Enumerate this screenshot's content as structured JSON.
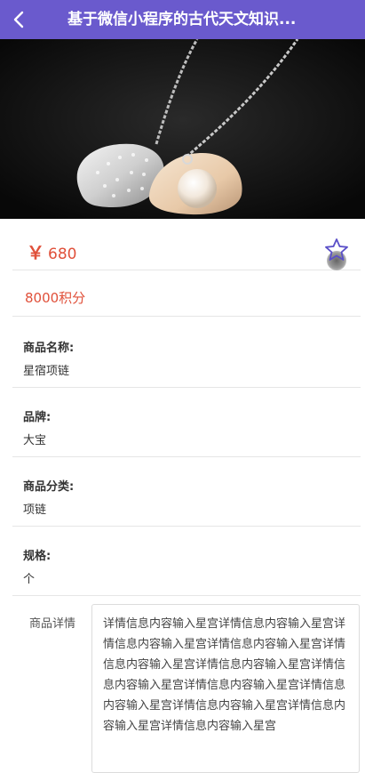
{
  "header": {
    "title": "基于微信小程序的古代天文知识...",
    "back_icon": "chevron-left-icon",
    "background": "#6a5acd"
  },
  "hero": {
    "image": "necklace-product-photo"
  },
  "price": {
    "symbol": "￥",
    "value": "680",
    "color": "#e0503a"
  },
  "favorite": {
    "icon": "star-icon"
  },
  "points": {
    "text": "8000积分"
  },
  "info": [
    {
      "label": "商品名称:",
      "value": "星宿项链"
    },
    {
      "label": "品牌:",
      "value": "大宝"
    },
    {
      "label": "商品分类:",
      "value": "项链"
    },
    {
      "label": "规格:",
      "value": "个"
    }
  ],
  "detail": {
    "label": "商品详情",
    "content": "详情信息内容输入星宫详情信息内容输入星宫详情信息内容输入星宫详情信息内容输入星宫详情信息内容输入星宫详情信息内容输入星宫详情信息内容输入星宫详情信息内容输入星宫详情信息内容输入星宫详情信息内容输入星宫详情信息内容输入星宫详情信息内容输入星宫"
  }
}
